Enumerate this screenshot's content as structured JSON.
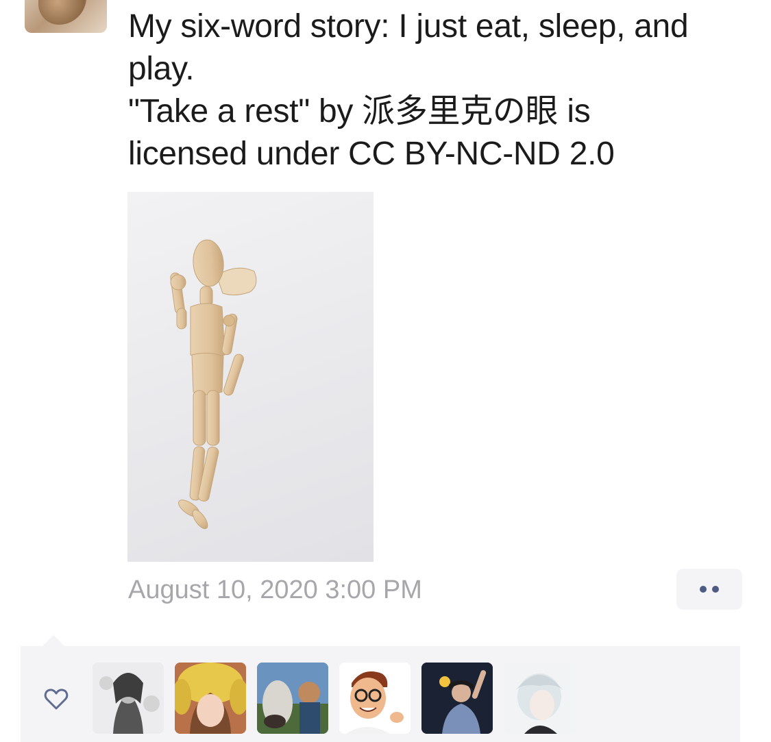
{
  "post": {
    "lines": [
      "My six-word story: I just eat, sleep, and",
      "play.",
      "\"Take a rest\" by 派多里克の眼 is",
      "licensed under CC BY-NC-ND 2.0"
    ],
    "timestamp": "August 10, 2020 3:00 PM"
  },
  "icons": {
    "like": "heart-outline-icon",
    "more": "more-dots-icon"
  },
  "likes": {
    "avatars": [
      {
        "name": "liker-avatar-1",
        "bg": "#e8e8ea"
      },
      {
        "name": "liker-avatar-2",
        "bg": "#c67e53"
      },
      {
        "name": "liker-avatar-3",
        "bg": "#5f86b2"
      },
      {
        "name": "liker-avatar-4",
        "bg": "#ffffff"
      },
      {
        "name": "liker-avatar-5",
        "bg": "#1a1f2e"
      },
      {
        "name": "liker-avatar-6",
        "bg": "#eef0f2"
      }
    ]
  },
  "colors": {
    "text": "#1b1b1b",
    "timestamp": "#a6a6ab",
    "accent": "#4f5b82",
    "panel": "#f4f4f6"
  }
}
